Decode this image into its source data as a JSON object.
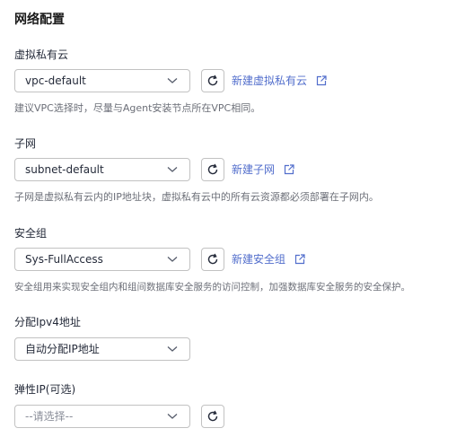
{
  "section": {
    "title": "网络配置"
  },
  "vpc": {
    "label": "虚拟私有云",
    "value": "vpc-default",
    "link": "新建虚拟私有云",
    "hint": "建议VPC选择时，尽量与Agent安装节点所在VPC相同。"
  },
  "subnet": {
    "label": "子网",
    "value": "subnet-default",
    "link": "新建子网",
    "hint": "子网是虚拟私有云内的IP地址块，虚拟私有云中的所有云资源都必须部署在子网内。"
  },
  "security_group": {
    "label": "安全组",
    "value": "Sys-FullAccess",
    "link": "新建安全组",
    "hint": "安全组用来实现安全组内和组间数据库安全服务的访问控制，加强数据库安全服务的安全保护。"
  },
  "ipv4": {
    "label": "分配Ipv4地址",
    "value": "自动分配IP地址"
  },
  "eip": {
    "label": "弹性IP(可选)",
    "placeholder": "--请选择--"
  },
  "colors": {
    "link": "#526ecc",
    "border": "#c2c2c2",
    "hint": "#6c6f78"
  },
  "icons": [
    "chevron-down-icon",
    "refresh-icon",
    "external-link-icon"
  ]
}
